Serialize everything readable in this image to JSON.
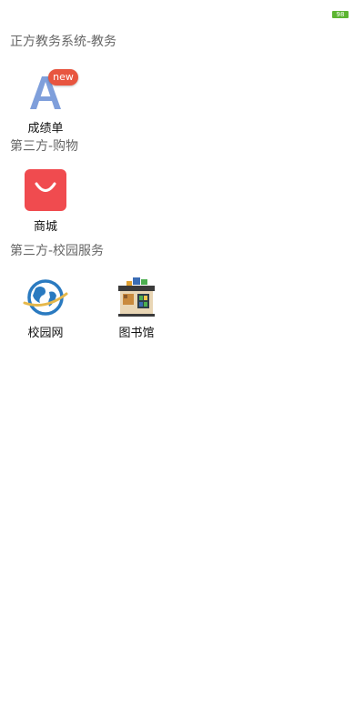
{
  "status_bar": {
    "battery": "98"
  },
  "sections": [
    {
      "title": "正方教务系统-教务",
      "apps": [
        {
          "label": "成绩单",
          "icon": "letter-a-icon",
          "badge": "new"
        }
      ]
    },
    {
      "title": "第三方-购物",
      "apps": [
        {
          "label": "商城",
          "icon": "shopping-bag-icon"
        }
      ]
    },
    {
      "title": "第三方-校园服务",
      "apps": [
        {
          "label": "校园网",
          "icon": "globe-icon"
        },
        {
          "label": "图书馆",
          "icon": "library-building-icon"
        }
      ]
    }
  ],
  "colors": {
    "section_title": "#666666",
    "badge": "#e8553f",
    "letter_icon": "#7f9fdb",
    "shop_icon": "#f04b4f",
    "battery": "#5cb531"
  }
}
